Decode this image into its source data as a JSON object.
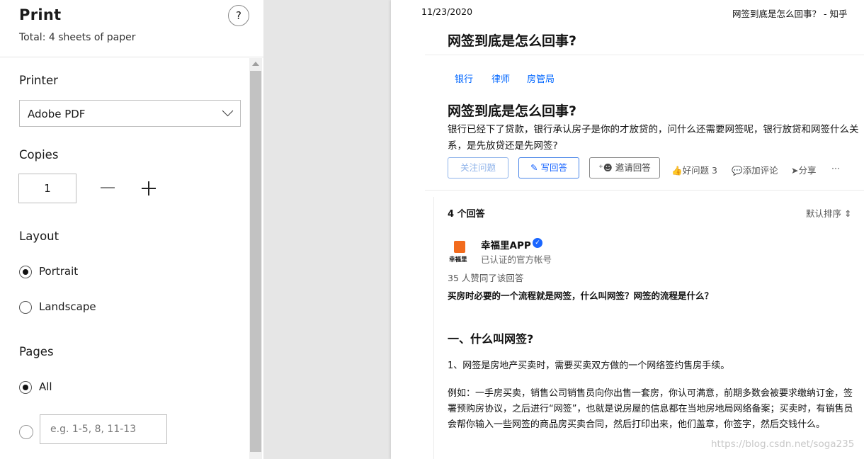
{
  "dialog": {
    "title": "Print",
    "sheets": "Total: 4 sheets of paper",
    "help": "?",
    "printer_label": "Printer",
    "printer_value": "Adobe PDF",
    "copies_label": "Copies",
    "copies_value": "1",
    "layout_label": "Layout",
    "layout_options": [
      "Portrait",
      "Landscape"
    ],
    "layout_selected": "Portrait",
    "pages_label": "Pages",
    "pages_options": [
      "All"
    ],
    "pages_selected": "All",
    "pages_range_placeholder": "e.g. 1-5, 8, 11-13"
  },
  "preview": {
    "header_date": "11/23/2020",
    "header_title": "网签到底是怎么回事？ - 知乎",
    "page_title": "网签到底是怎么回事?",
    "topics": [
      "银行",
      "律师",
      "房管局"
    ],
    "question_title": "网签到底是怎么回事?",
    "question_desc": "银行已经下了贷款，银行承认房子是你的才放贷的，问什么还需要网签呢，银行放贷和网签什么关系，是先放贷还是先网签?",
    "btn_follow": "关注问题",
    "btn_answer": "写回答",
    "btn_invite": "邀请回答",
    "act_like": "好问题 3",
    "act_comment": "添加评论",
    "act_share": "分享",
    "act_more": "···",
    "answer_count": "4 个回答",
    "sort": "默认排序",
    "logo_text": "幸福里",
    "author": "幸福里APP",
    "author_sub": "已认证的官方帐号",
    "votes": "35 人赞同了该回答",
    "lead": "买房时必要的一个流程就是网签，什么叫网签？网签的流程是什么？",
    "h2": "一、什么叫网签?",
    "para1": "1、网签是房地产买卖时，需要买卖双方做的一个网络签约售房手续。",
    "para2": "例如：一手房买卖，销售公司销售员向你出售一套房，你认可满意，前期多数会被要求缴纳订金，签署预购房协议，之后进行“网签”，也就是说房屋的信息都在当地房地局网络备案；买卖时，有销售员会帮你输入一些网签的商品房买卖合同，然后打印出来，他们盖章，你签字，然后交钱什么。",
    "watermark": "https://blog.csdn.net/soga235"
  },
  "colors": {
    "accent": "#0066ff",
    "logo": "#f26b1d"
  }
}
